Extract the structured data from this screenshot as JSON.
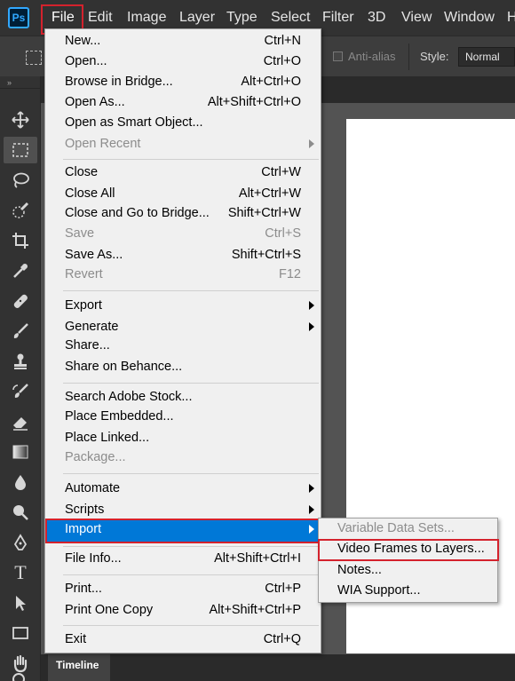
{
  "app": {
    "logo_text": "Ps"
  },
  "menubar": {
    "items": [
      "File",
      "Edit",
      "Image",
      "Layer",
      "Type",
      "Select",
      "Filter",
      "3D",
      "View",
      "Window",
      "H"
    ]
  },
  "options": {
    "anti_alias_label": "Anti-alias",
    "style_label": "Style:",
    "style_value": "Normal"
  },
  "toolbar": {
    "collapse_glyph": "»",
    "tools": [
      "move-icon",
      "rectangular-marquee-icon",
      "lasso-icon",
      "quick-selection-icon",
      "crop-icon",
      "eyedropper-icon",
      "healing-brush-icon",
      "brush-icon",
      "clone-stamp-icon",
      "history-brush-icon",
      "eraser-icon",
      "gradient-icon",
      "blur-icon",
      "dodge-icon",
      "pen-icon",
      "type-icon",
      "path-selection-icon",
      "rectangle-icon",
      "hand-icon",
      "zoom-icon"
    ],
    "type_glyph": "T"
  },
  "file_menu": {
    "items": [
      {
        "label": "New...",
        "shortcut": "Ctrl+N"
      },
      {
        "label": "Open...",
        "shortcut": "Ctrl+O"
      },
      {
        "label": "Browse in Bridge...",
        "shortcut": "Alt+Ctrl+O"
      },
      {
        "label": "Open As...",
        "shortcut": "Alt+Shift+Ctrl+O"
      },
      {
        "label": "Open as Smart Object...",
        "shortcut": ""
      },
      {
        "label": "Open Recent",
        "shortcut": "",
        "disabled": true,
        "submenu": true
      },
      {
        "label": "Close",
        "shortcut": "Ctrl+W"
      },
      {
        "label": "Close All",
        "shortcut": "Alt+Ctrl+W"
      },
      {
        "label": "Close and Go to Bridge...",
        "shortcut": "Shift+Ctrl+W"
      },
      {
        "label": "Save",
        "shortcut": "Ctrl+S",
        "disabled": true
      },
      {
        "label": "Save As...",
        "shortcut": "Shift+Ctrl+S"
      },
      {
        "label": "Revert",
        "shortcut": "F12",
        "disabled": true
      },
      {
        "label": "Export",
        "shortcut": "",
        "submenu": true
      },
      {
        "label": "Generate",
        "shortcut": "",
        "submenu": true
      },
      {
        "label": "Share...",
        "shortcut": ""
      },
      {
        "label": "Share on Behance...",
        "shortcut": ""
      },
      {
        "label": "Search Adobe Stock...",
        "shortcut": ""
      },
      {
        "label": "Place Embedded...",
        "shortcut": ""
      },
      {
        "label": "Place Linked...",
        "shortcut": ""
      },
      {
        "label": "Package...",
        "shortcut": "",
        "disabled": true
      },
      {
        "label": "Automate",
        "shortcut": "",
        "submenu": true
      },
      {
        "label": "Scripts",
        "shortcut": "",
        "submenu": true
      },
      {
        "label": "Import",
        "shortcut": "",
        "submenu": true,
        "highlighted": true
      },
      {
        "label": "File Info...",
        "shortcut": "Alt+Shift+Ctrl+I"
      },
      {
        "label": "Print...",
        "shortcut": "Ctrl+P"
      },
      {
        "label": "Print One Copy",
        "shortcut": "Alt+Shift+Ctrl+P"
      },
      {
        "label": "Exit",
        "shortcut": "Ctrl+Q"
      }
    ]
  },
  "import_menu": {
    "items": [
      {
        "label": "Variable Data Sets...",
        "disabled": true
      },
      {
        "label": "Video Frames to Layers..."
      },
      {
        "label": "Notes..."
      },
      {
        "label": "WIA Support..."
      }
    ]
  },
  "timeline": {
    "tab_label": "Timeline"
  },
  "colors": {
    "highlight": "#0078d7",
    "annotation_red": "#d4222d",
    "ps_blue": "#31a8ff"
  }
}
